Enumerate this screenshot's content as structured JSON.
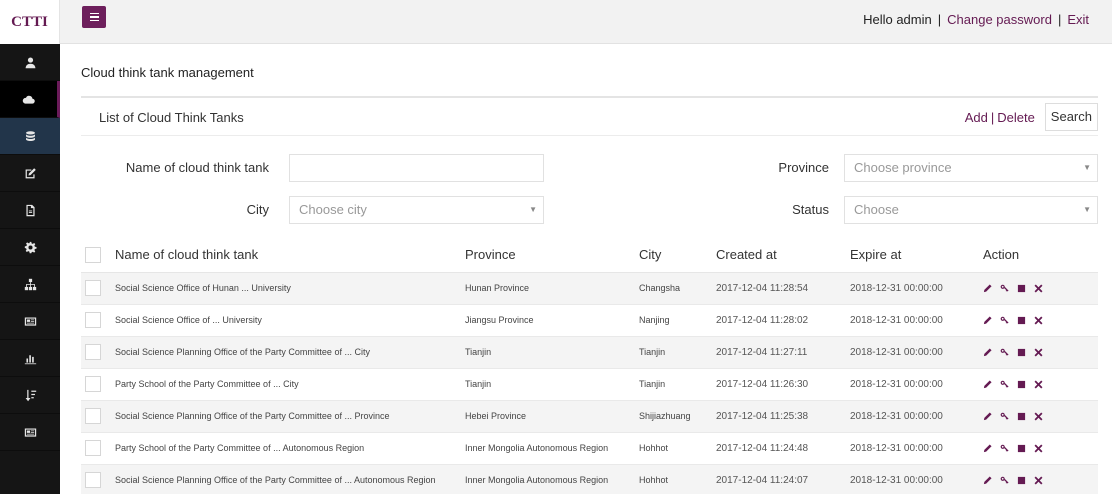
{
  "brand": "CTTI",
  "header": {
    "greeting": "Hello admin",
    "change_password": "Change password",
    "exit": "Exit"
  },
  "nav": [
    {
      "icon": "user-icon"
    },
    {
      "icon": "cloud-icon"
    },
    {
      "icon": "database-icon"
    },
    {
      "icon": "edit-icon"
    },
    {
      "icon": "file-icon"
    },
    {
      "icon": "gear-icon"
    },
    {
      "icon": "sitemap-icon"
    },
    {
      "icon": "newspaper-icon"
    },
    {
      "icon": "bar-chart-icon"
    },
    {
      "icon": "sort-icon"
    },
    {
      "icon": "newspaper-icon"
    }
  ],
  "page_title": "Cloud think tank management",
  "panel": {
    "title": "List of Cloud Think Tanks",
    "add": "Add",
    "delete": "Delete",
    "search": "Search"
  },
  "filters": {
    "name_label": "Name of cloud think tank",
    "name_value": "",
    "province_label": "Province",
    "province_placeholder": "Choose province",
    "city_label": "City",
    "city_placeholder": "Choose city",
    "status_label": "Status",
    "status_placeholder": "Choose"
  },
  "table": {
    "columns": [
      "Name of cloud think tank",
      "Province",
      "City",
      "Created at",
      "Expire at",
      "Action"
    ],
    "rows": [
      {
        "name": "Social Science Office of Hunan ... University",
        "province": "Hunan Province",
        "city": "Changsha",
        "created": "2017-12-04 11:28:54",
        "expire": "2018-12-31 00:00:00"
      },
      {
        "name": "Social Science Office of ... University",
        "province": "Jiangsu Province",
        "city": "Nanjing",
        "created": "2017-12-04 11:28:02",
        "expire": "2018-12-31 00:00:00"
      },
      {
        "name": "Social Science Planning Office of the Party Committee of ... City",
        "province": "Tianjin",
        "city": "Tianjin",
        "created": "2017-12-04 11:27:11",
        "expire": "2018-12-31 00:00:00"
      },
      {
        "name": "Party School of the Party Committee of ... City",
        "province": "Tianjin",
        "city": "Tianjin",
        "created": "2017-12-04 11:26:30",
        "expire": "2018-12-31 00:00:00"
      },
      {
        "name": "Social Science Planning Office of the Party Committee of ... Province",
        "province": "Hebei Province",
        "city": "Shijiazhuang",
        "created": "2017-12-04 11:25:38",
        "expire": "2018-12-31 00:00:00"
      },
      {
        "name": "Party School of the Party Committee of ... Autonomous Region",
        "province": "Inner Mongolia Autonomous Region",
        "city": "Hohhot",
        "created": "2017-12-04 11:24:48",
        "expire": "2018-12-31 00:00:00"
      },
      {
        "name": "Social Science Planning Office of the Party Committee of ... Autonomous Region",
        "province": "Inner Mongolia Autonomous Region",
        "city": "Hohhot",
        "created": "2017-12-04 11:24:07",
        "expire": "2018-12-31 00:00:00"
      }
    ],
    "actions": [
      "edit-icon",
      "key-icon",
      "stop-icon",
      "delete-icon"
    ]
  },
  "colors": {
    "accent": "#641a52",
    "sidebar": "#151515",
    "sidebar_highlight": "#22354a"
  }
}
